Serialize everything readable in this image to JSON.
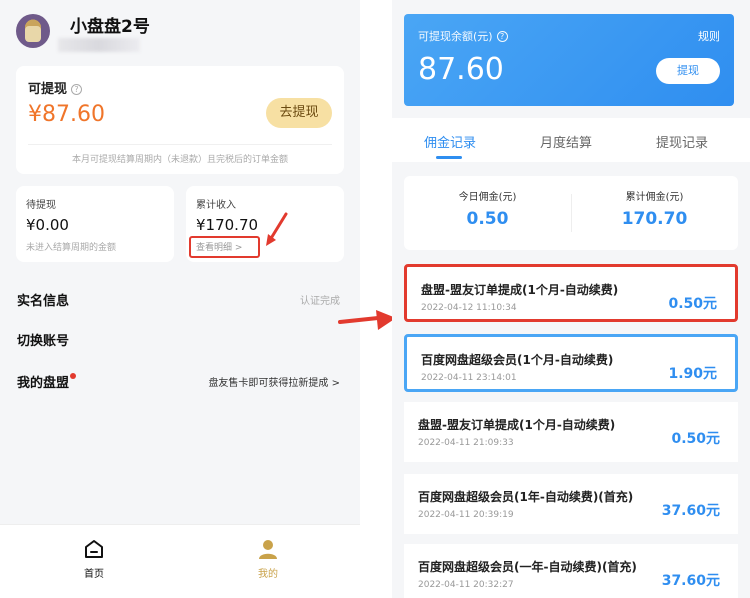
{
  "left": {
    "profile": {
      "username": "小盘盘2号"
    },
    "withdrawable": {
      "title": "可提现",
      "info_icon": "ⓘ",
      "amount": "¥87.60",
      "button_label": "去提现",
      "note": "本月可提现结算周期内（未退款）且完税后的订单金额"
    },
    "pending": {
      "label": "待提现",
      "value": "¥0.00",
      "sub": "未进入结算周期的金额"
    },
    "total_income": {
      "label": "累计收入",
      "value": "¥170.70",
      "detail_link": "查看明细 >"
    },
    "rows": [
      {
        "label": "实名信息",
        "value": "认证完成"
      },
      {
        "label": "切换账号",
        "value": ""
      },
      {
        "label": "我的盘盟",
        "value": "盘友售卡即可获得拉新提成 >"
      }
    ],
    "tabbar": [
      {
        "label": "首页",
        "icon": "home-icon",
        "color": "#111111"
      },
      {
        "label": "我的",
        "icon": "user-icon",
        "color": "#c9a24a"
      }
    ],
    "colors": {
      "accent_orange": "#f0752a",
      "highlight_red": "#e23a2e"
    }
  },
  "right": {
    "balance": {
      "label": "可提现余额(元)",
      "info_icon": "ⓘ",
      "rule_label": "规则",
      "amount": "87.60",
      "button_label": "提现"
    },
    "tabs": [
      {
        "label": "佣金记录",
        "active": true
      },
      {
        "label": "月度结算",
        "active": false
      },
      {
        "label": "提现记录",
        "active": false
      }
    ],
    "stats": [
      {
        "label": "今日佣金(元)",
        "value": "0.50"
      },
      {
        "label": "累计佣金(元)",
        "value": "170.70"
      }
    ],
    "records": [
      {
        "title": "盘盟-盟友订单提成(1个月-自动续费)",
        "time": "2022-04-12 11:10:34",
        "amount": "0.50元",
        "highlight": "red"
      },
      {
        "title": "百度网盘超级会员(1个月-自动续费)",
        "time": "2022-04-11 23:14:01",
        "amount": "1.90元",
        "highlight": "blue"
      },
      {
        "title": "盘盟-盟友订单提成(1个月-自动续费)",
        "time": "2022-04-11 21:09:33",
        "amount": "0.50元",
        "highlight": ""
      },
      {
        "title": "百度网盘超级会员(1年-自动续费)(首充)",
        "time": "2022-04-11 20:39:19",
        "amount": "37.60元",
        "highlight": ""
      },
      {
        "title": "百度网盘超级会员(一年-自动续费)(首充)",
        "time": "2022-04-11 20:32:27",
        "amount": "37.60元",
        "highlight": ""
      }
    ],
    "colors": {
      "accent_blue": "#2f8ef0",
      "highlight_blue": "#4aa6f5"
    }
  }
}
